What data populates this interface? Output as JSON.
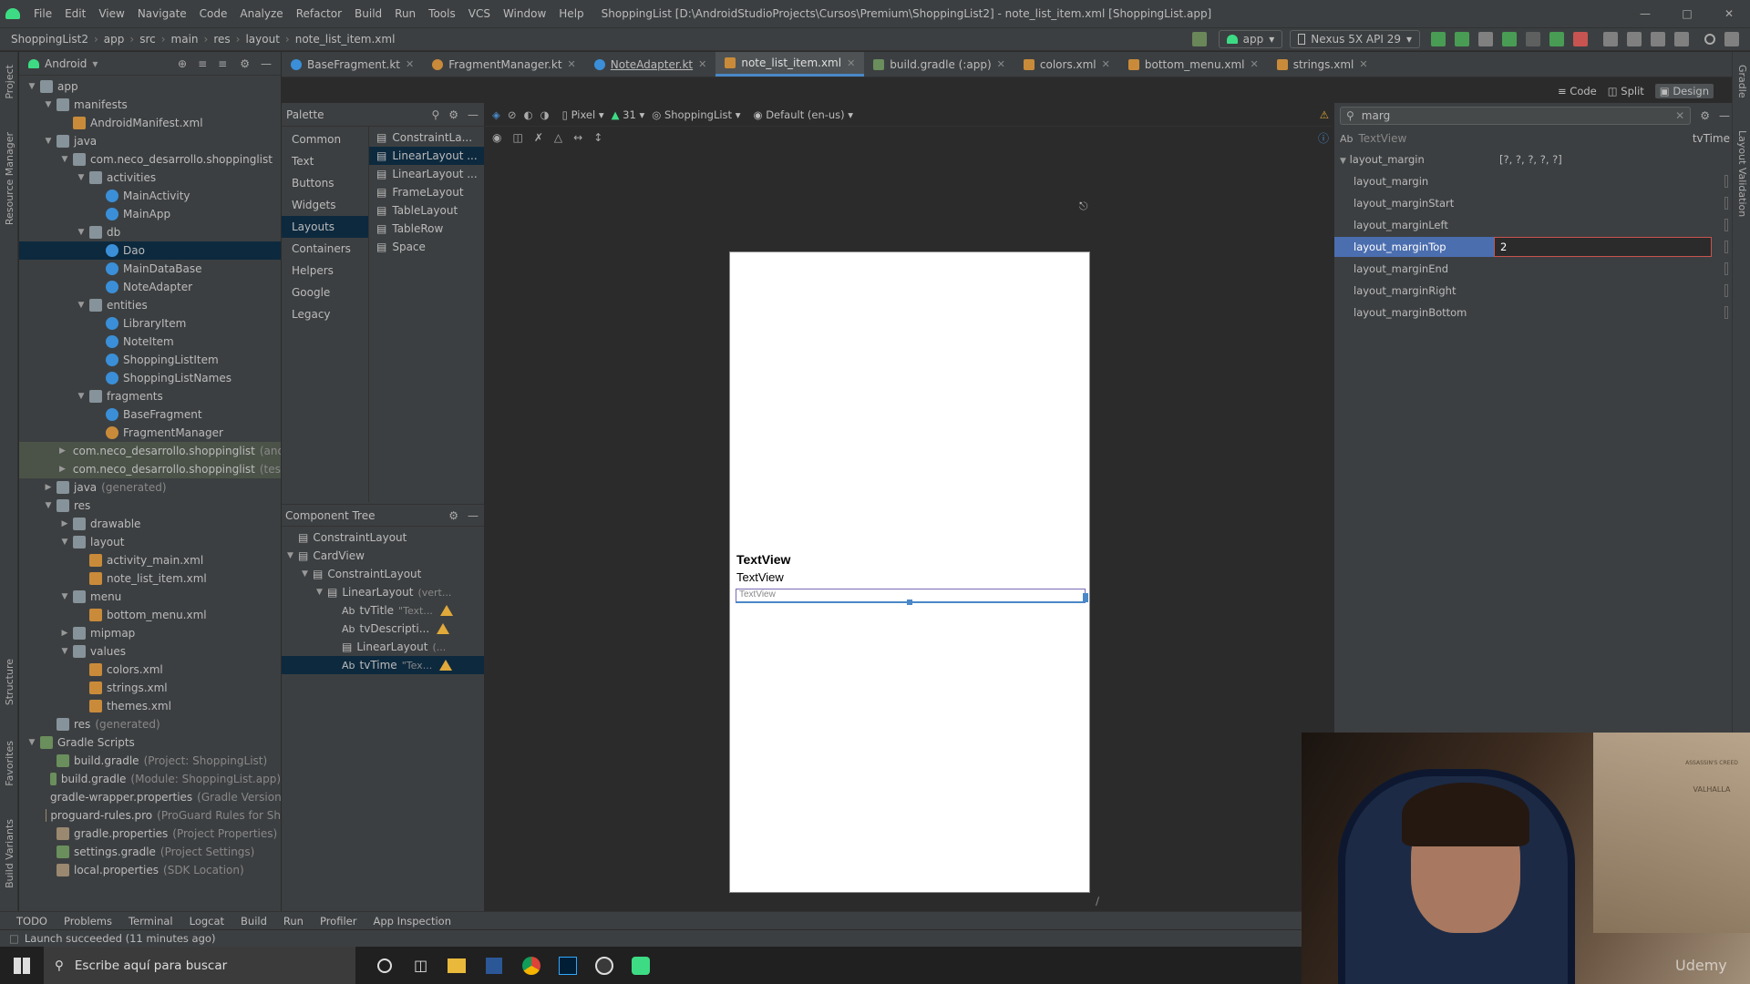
{
  "titlebar": {
    "menu": [
      "File",
      "Edit",
      "View",
      "Navigate",
      "Code",
      "Analyze",
      "Refactor",
      "Build",
      "Run",
      "Tools",
      "VCS",
      "Window",
      "Help"
    ],
    "title": "ShoppingList [D:\\AndroidStudioProjects\\Cursos\\Premium\\ShoppingList2] - note_list_item.xml [ShoppingList.app]"
  },
  "navbar": {
    "crumbs": [
      "ShoppingList2",
      "app",
      "src",
      "main",
      "res",
      "layout",
      "note_list_item.xml"
    ],
    "run_config": "app",
    "device": "Nexus 5X API 29"
  },
  "project": {
    "view": "Android",
    "tree": [
      {
        "label": "app",
        "depth": 0,
        "arrow": "open",
        "icon": "folder"
      },
      {
        "label": "manifests",
        "depth": 1,
        "arrow": "open",
        "icon": "folder"
      },
      {
        "label": "AndroidManifest.xml",
        "depth": 2,
        "arrow": "",
        "icon": "xml"
      },
      {
        "label": "java",
        "depth": 1,
        "arrow": "open",
        "icon": "folder"
      },
      {
        "label": "com.neco_desarrollo.shoppinglist",
        "depth": 2,
        "arrow": "open",
        "icon": "package"
      },
      {
        "label": "activities",
        "depth": 3,
        "arrow": "open",
        "icon": "package"
      },
      {
        "label": "MainActivity",
        "depth": 4,
        "arrow": "",
        "icon": "kotlin"
      },
      {
        "label": "MainApp",
        "depth": 4,
        "arrow": "",
        "icon": "kotlin"
      },
      {
        "label": "db",
        "depth": 3,
        "arrow": "open",
        "icon": "package"
      },
      {
        "label": "Dao",
        "depth": 4,
        "arrow": "",
        "icon": "kotlin",
        "sel": true
      },
      {
        "label": "MainDataBase",
        "depth": 4,
        "arrow": "",
        "icon": "kotlin"
      },
      {
        "label": "NoteAdapter",
        "depth": 4,
        "arrow": "",
        "icon": "kotlin"
      },
      {
        "label": "entities",
        "depth": 3,
        "arrow": "open",
        "icon": "package"
      },
      {
        "label": "LibraryItem",
        "depth": 4,
        "arrow": "",
        "icon": "kotlin"
      },
      {
        "label": "NoteItem",
        "depth": 4,
        "arrow": "",
        "icon": "kotlin"
      },
      {
        "label": "ShoppingListItem",
        "depth": 4,
        "arrow": "",
        "icon": "kotlin"
      },
      {
        "label": "ShoppingListNames",
        "depth": 4,
        "arrow": "",
        "icon": "kotlin"
      },
      {
        "label": "fragments",
        "depth": 3,
        "arrow": "open",
        "icon": "package"
      },
      {
        "label": "BaseFragment",
        "depth": 4,
        "arrow": "",
        "icon": "kotlin"
      },
      {
        "label": "FragmentManager",
        "depth": 4,
        "arrow": "",
        "icon": "kotlin-obj"
      },
      {
        "label": "com.neco_desarrollo.shoppinglist",
        "suffix": "(andr",
        "depth": 2,
        "arrow": "closed",
        "icon": "package",
        "hl": true
      },
      {
        "label": "com.neco_desarrollo.shoppinglist",
        "suffix": "(test)",
        "depth": 2,
        "arrow": "closed",
        "icon": "package",
        "hl": true
      },
      {
        "label": "java",
        "suffix": "(generated)",
        "depth": 1,
        "arrow": "closed",
        "icon": "folder"
      },
      {
        "label": "res",
        "depth": 1,
        "arrow": "open",
        "icon": "folder"
      },
      {
        "label": "drawable",
        "depth": 2,
        "arrow": "closed",
        "icon": "folder"
      },
      {
        "label": "layout",
        "depth": 2,
        "arrow": "open",
        "icon": "folder"
      },
      {
        "label": "activity_main.xml",
        "depth": 3,
        "arrow": "",
        "icon": "xml"
      },
      {
        "label": "note_list_item.xml",
        "depth": 3,
        "arrow": "",
        "icon": "xml"
      },
      {
        "label": "menu",
        "depth": 2,
        "arrow": "open",
        "icon": "folder"
      },
      {
        "label": "bottom_menu.xml",
        "depth": 3,
        "arrow": "",
        "icon": "xml"
      },
      {
        "label": "mipmap",
        "depth": 2,
        "arrow": "closed",
        "icon": "folder"
      },
      {
        "label": "values",
        "depth": 2,
        "arrow": "open",
        "icon": "folder"
      },
      {
        "label": "colors.xml",
        "depth": 3,
        "arrow": "",
        "icon": "xml"
      },
      {
        "label": "strings.xml",
        "depth": 3,
        "arrow": "",
        "icon": "xml"
      },
      {
        "label": "themes.xml",
        "depth": 3,
        "arrow": "",
        "icon": "xml"
      },
      {
        "label": "res",
        "suffix": "(generated)",
        "depth": 1,
        "arrow": "",
        "icon": "folder"
      },
      {
        "label": "Gradle Scripts",
        "depth": 0,
        "arrow": "open",
        "icon": "gradle"
      },
      {
        "label": "build.gradle",
        "suffix": "(Project: ShoppingList)",
        "depth": 1,
        "arrow": "",
        "icon": "gradle"
      },
      {
        "label": "build.gradle",
        "suffix": "(Module: ShoppingList.app)",
        "depth": 1,
        "arrow": "",
        "icon": "gradle"
      },
      {
        "label": "gradle-wrapper.properties",
        "suffix": "(Gradle Version)",
        "depth": 1,
        "arrow": "",
        "icon": "props"
      },
      {
        "label": "proguard-rules.pro",
        "suffix": "(ProGuard Rules for Sh",
        "depth": 1,
        "arrow": "",
        "icon": "props"
      },
      {
        "label": "gradle.properties",
        "suffix": "(Project Properties)",
        "depth": 1,
        "arrow": "",
        "icon": "props"
      },
      {
        "label": "settings.gradle",
        "suffix": "(Project Settings)",
        "depth": 1,
        "arrow": "",
        "icon": "gradle"
      },
      {
        "label": "local.properties",
        "suffix": "(SDK Location)",
        "depth": 1,
        "arrow": "",
        "icon": "props"
      }
    ]
  },
  "tabs": [
    {
      "label": "BaseFragment.kt",
      "icon": "kotlin"
    },
    {
      "label": "FragmentManager.kt",
      "icon": "kotlin-obj"
    },
    {
      "label": "NoteAdapter.kt",
      "icon": "kotlin"
    },
    {
      "label": "note_list_item.xml",
      "icon": "xml",
      "active": true
    },
    {
      "label": "build.gradle (:app)",
      "icon": "gradle"
    },
    {
      "label": "colors.xml",
      "icon": "xml"
    },
    {
      "label": "bottom_menu.xml",
      "icon": "xml"
    },
    {
      "label": "strings.xml",
      "icon": "xml"
    }
  ],
  "view_modes": {
    "code": "Code",
    "split": "Split",
    "design": "Design"
  },
  "palette": {
    "title": "Palette",
    "categories": [
      "Common",
      "Text",
      "Buttons",
      "Widgets",
      "Layouts",
      "Containers",
      "Helpers",
      "Google",
      "Legacy"
    ],
    "active_category": "Layouts",
    "items": [
      "ConstraintLa...",
      "LinearLayout ...",
      "LinearLayout ...",
      "FrameLayout",
      "TableLayout",
      "TableRow",
      "Space"
    ]
  },
  "design_toolbar": {
    "device": "Pixel",
    "api": "31",
    "theme": "ShoppingList",
    "locale": "Default (en-us)"
  },
  "component_tree": {
    "title": "Component Tree",
    "items": [
      {
        "label": "ConstraintLayout",
        "depth": 0,
        "arrow": ""
      },
      {
        "label": "CardView",
        "depth": 0,
        "arrow": "open"
      },
      {
        "label": "ConstraintLayout",
        "depth": 1,
        "arrow": "open"
      },
      {
        "label": "LinearLayout",
        "suffix": "(vert...",
        "depth": 2,
        "arrow": "open"
      },
      {
        "label": "tvTitle",
        "prefix": "Ab",
        "suffix": "\"Text...",
        "depth": 3,
        "warn": true
      },
      {
        "label": "tvDescripti...",
        "prefix": "Ab",
        "depth": 3,
        "warn": true
      },
      {
        "label": "LinearLayout",
        "suffix": "(...",
        "depth": 3
      },
      {
        "label": "tvTime",
        "prefix": "Ab",
        "suffix": "\"Tex...",
        "depth": 3,
        "warn": true,
        "sel": true
      }
    ]
  },
  "device_preview": {
    "line1": "TextView",
    "line2": "TextView",
    "line3": "TextView"
  },
  "attributes": {
    "search": "marg",
    "component_type": "TextView",
    "component_id": "tvTime",
    "group_label": "layout_margin",
    "group_value": "[?, ?, ?, ?, ?]",
    "rows": [
      {
        "key": "layout_margin",
        "value": ""
      },
      {
        "key": "layout_marginStart",
        "value": ""
      },
      {
        "key": "layout_marginLeft",
        "value": ""
      },
      {
        "key": "layout_marginTop",
        "value": "2",
        "active": true
      },
      {
        "key": "layout_marginEnd",
        "value": ""
      },
      {
        "key": "layout_marginRight",
        "value": ""
      },
      {
        "key": "layout_marginBottom",
        "value": ""
      }
    ]
  },
  "left_stripe": {
    "project": "Project",
    "resource": "Resource Manager",
    "structure": "Structure",
    "favorites": "Favorites",
    "variants": "Build Variants"
  },
  "right_stripe": {
    "gradle": "Gradle",
    "validation": "Layout Validation"
  },
  "bottom_tools": [
    "TODO",
    "Problems",
    "Terminal",
    "Logcat",
    "Build",
    "Run",
    "Profiler",
    "App Inspection"
  ],
  "status": "Launch succeeded (11 minutes ago)",
  "taskbar": {
    "search_placeholder": "Escribe aquí para buscar"
  },
  "webcam": {
    "watermark": "Udemy",
    "poster_title": "ASSASSIN'S CREED",
    "poster_sub": "VALHALLA"
  },
  "colors": {
    "accent": "#4a88c7",
    "kotlin": "#3a8fd8",
    "xml": "#c98b3a",
    "folder": "#87939a",
    "warn": "#e0a93a",
    "selection": "#0d293e"
  }
}
